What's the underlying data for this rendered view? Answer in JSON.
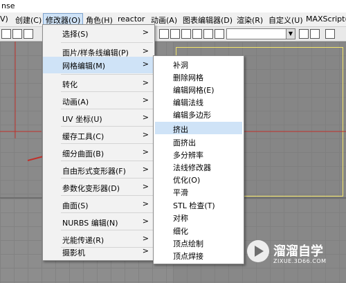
{
  "window": {
    "title_fragment": "nse"
  },
  "menubar": {
    "items": [
      {
        "label": "V)"
      },
      {
        "label": "创建(C)"
      },
      {
        "label": "修改器(O)"
      },
      {
        "label": "角色(H)"
      },
      {
        "label": "reactor"
      },
      {
        "label": "动画(A)"
      },
      {
        "label": "图表编辑器(D)"
      },
      {
        "label": "渲染(R)"
      },
      {
        "label": "自定义(U)"
      },
      {
        "label": "MAXScript("
      }
    ]
  },
  "toolbar": {
    "selection_dropdown_value": ""
  },
  "modifiers_menu": {
    "items": [
      {
        "label": "选择(S)",
        "has_submenu": ">"
      },
      {
        "label": "面片/样条线编辑(P)",
        "has_submenu": ">"
      },
      {
        "label": "网格编辑(M)",
        "has_submenu": ">"
      },
      {
        "label": "转化",
        "has_submenu": ">"
      },
      {
        "label": "动画(A)",
        "has_submenu": ">"
      },
      {
        "label": "UV 坐标(U)",
        "has_submenu": ">"
      },
      {
        "label": "缓存工具(C)",
        "has_submenu": ">"
      },
      {
        "label": "细分曲面(B)",
        "has_submenu": ">"
      },
      {
        "label": "自由形式变形器(F)",
        "has_submenu": ">"
      },
      {
        "label": "参数化变形器(D)",
        "has_submenu": ">"
      },
      {
        "label": "曲面(S)",
        "has_submenu": ">"
      },
      {
        "label": "NURBS 编辑(N)",
        "has_submenu": ">"
      },
      {
        "label": "光能传递(R)",
        "has_submenu": ">"
      },
      {
        "label": "摄影机",
        "has_submenu": ">"
      }
    ]
  },
  "mesh_edit_submenu": {
    "items": [
      {
        "label": "补洞"
      },
      {
        "label": "删除网格"
      },
      {
        "label": "编辑网格(E)"
      },
      {
        "label": "编辑法线"
      },
      {
        "label": "编辑多边形"
      },
      {
        "label": "挤出"
      },
      {
        "label": "面挤出"
      },
      {
        "label": "多分辨率"
      },
      {
        "label": "法线修改器"
      },
      {
        "label": "优化(O)"
      },
      {
        "label": "平滑"
      },
      {
        "label": "STL 检查(T)"
      },
      {
        "label": "对称"
      },
      {
        "label": "细化"
      },
      {
        "label": "顶点绘制"
      },
      {
        "label": "顶点焊接"
      }
    ]
  },
  "watermark": {
    "brand": "溜溜自学",
    "url": "ZIXUE.3D66.COM"
  },
  "colors": {
    "highlight": "#cfe3f7",
    "annotation_arrow": "#c0302a",
    "viewport_border": "#f5e76a"
  }
}
